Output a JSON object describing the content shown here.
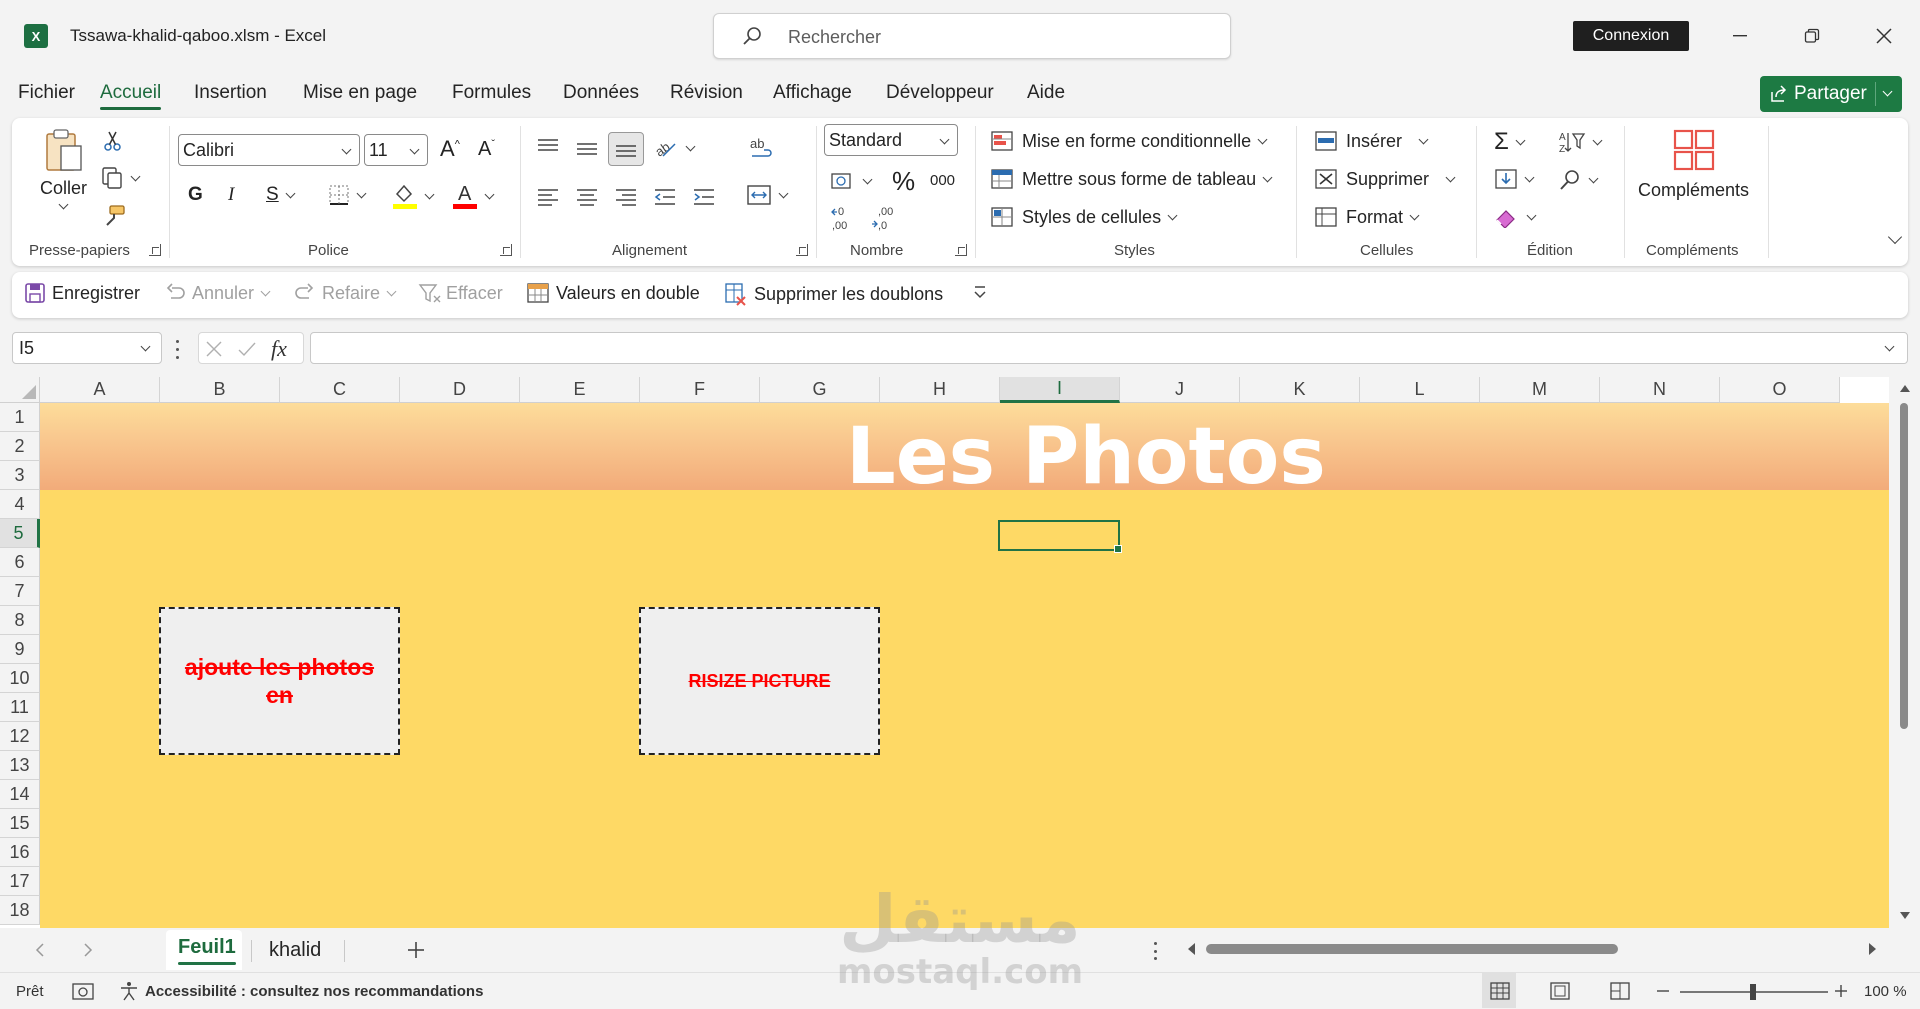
{
  "window": {
    "title": "Tssawa-khalid-qaboo.xlsm  -  Excel",
    "search_placeholder": "Rechercher",
    "signin_label": "Connexion"
  },
  "menu_tabs": [
    "Fichier",
    "Accueil",
    "Insertion",
    "Mise en page",
    "Formules",
    "Données",
    "Révision",
    "Affichage",
    "Développeur",
    "Aide"
  ],
  "active_tab": "Accueil",
  "share_label": "Partager",
  "ribbon": {
    "clipboard": {
      "paste_label": "Coller",
      "group_label": "Presse-papiers"
    },
    "font": {
      "name": "Calibri",
      "size": "11",
      "group_label": "Police",
      "highlight_color": "#ffff00",
      "font_color": "#ff0000"
    },
    "alignment": {
      "group_label": "Alignement"
    },
    "number": {
      "format": "Standard",
      "group_label": "Nombre",
      "thousands_label": "000"
    },
    "styles": {
      "conditional": "Mise en forme conditionnelle",
      "table": "Mettre sous forme de tableau",
      "cell_styles": "Styles de cellules",
      "group_label": "Styles"
    },
    "cells": {
      "insert": "Insérer",
      "delete": "Supprimer",
      "format": "Format",
      "group_label": "Cellules"
    },
    "editing": {
      "group_label": "Édition"
    },
    "addins": {
      "label": "Compléments",
      "group_label": "Compléments"
    }
  },
  "qat": {
    "save": "Enregistrer",
    "undo": "Annuler",
    "redo": "Refaire",
    "clear": "Effacer",
    "duplicates": "Valeurs en double",
    "remove_duplicates": "Supprimer les doublons"
  },
  "formula_bar": {
    "name_box": "I5",
    "fx_label": "fx",
    "formula": ""
  },
  "columns": [
    "A",
    "B",
    "C",
    "D",
    "E",
    "F",
    "G",
    "H",
    "I",
    "J",
    "K",
    "L",
    "M",
    "N",
    "O"
  ],
  "selected_column": "I",
  "rows": [
    "1",
    "2",
    "3",
    "4",
    "5",
    "6",
    "7",
    "8",
    "9",
    "10",
    "11",
    "12",
    "13",
    "14",
    "15",
    "16",
    "17",
    "18"
  ],
  "selected_row": "5",
  "sheet": {
    "banner_title": "Les Photos",
    "button1_text": "ajoute les photos en",
    "button2_text": "RISIZE PICTURE",
    "sheet_color": "#fed965"
  },
  "sheet_tabs": [
    "Feuil1",
    "khalid"
  ],
  "active_sheet": "Feuil1",
  "status": {
    "ready": "Prêt",
    "accessibility": "Accessibilité : consultez nos recommandations",
    "zoom": "100 %"
  },
  "watermark": {
    "arabic": "مستقل",
    "latin": "mostaql.com"
  }
}
